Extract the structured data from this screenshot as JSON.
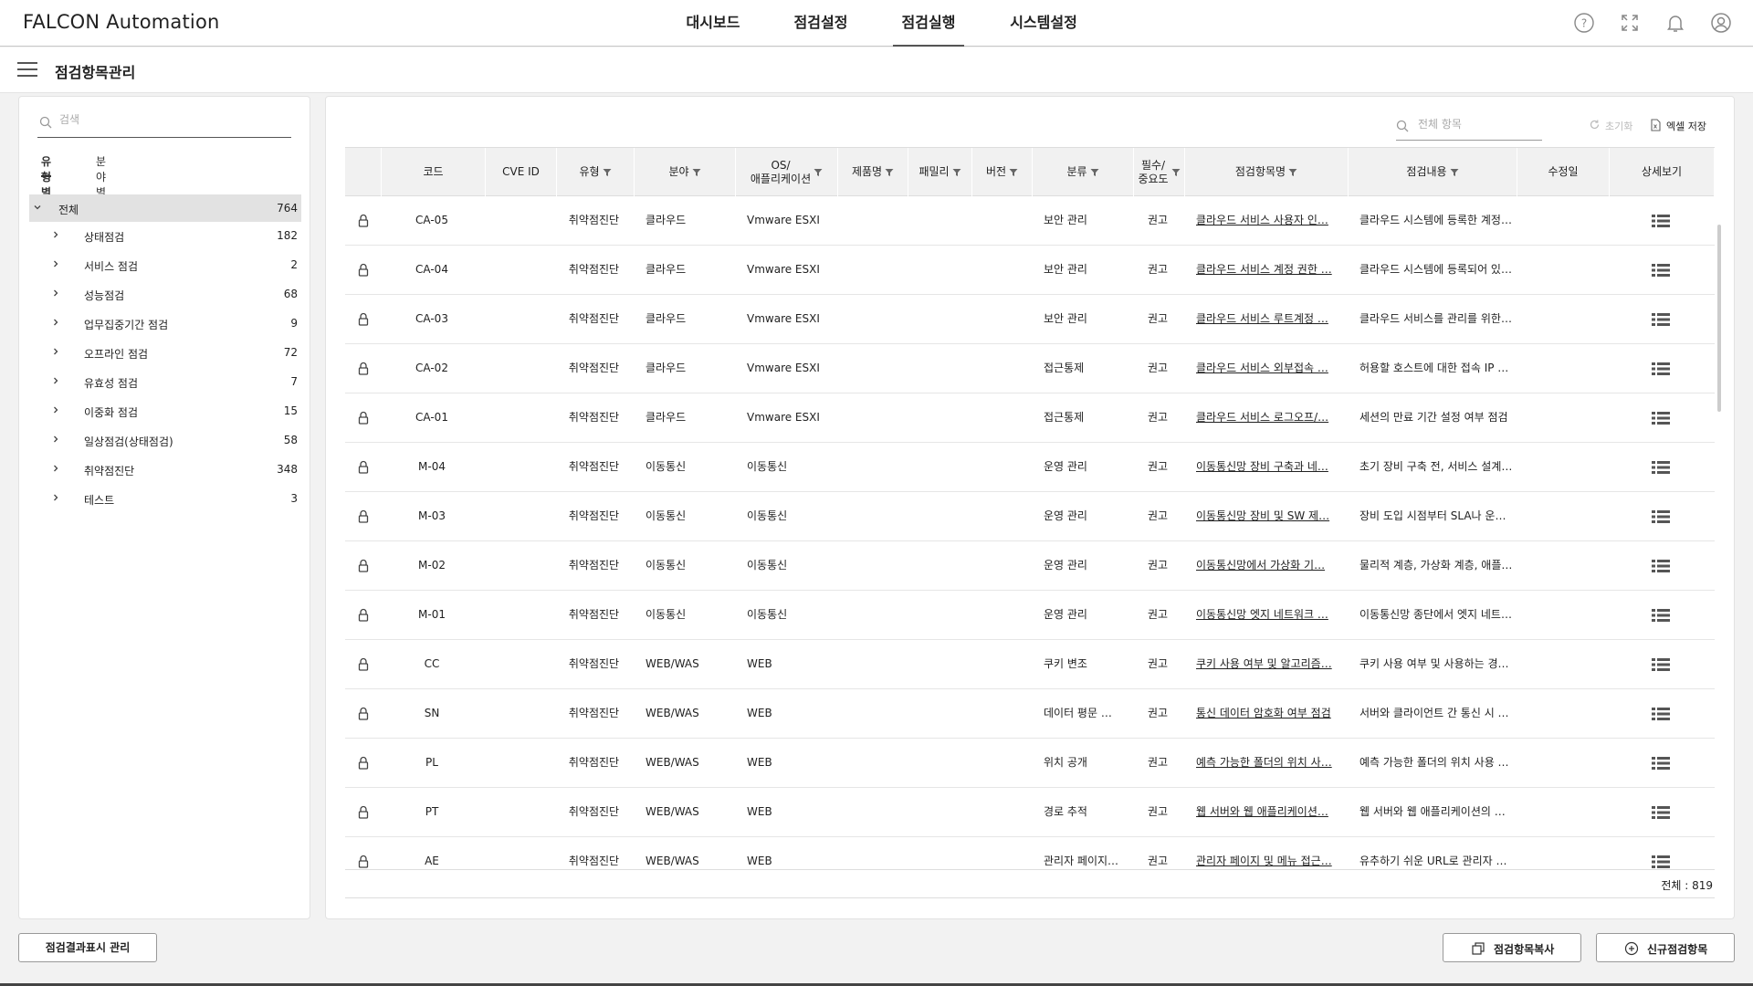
{
  "app": {
    "title": "FALCON Automation"
  },
  "nav": {
    "items": [
      "대시보드",
      "점검설정",
      "점검실행",
      "시스템설정"
    ],
    "active_index": 2
  },
  "header_icons": [
    "help-icon",
    "fullscreen-icon",
    "bell-icon",
    "user-icon"
  ],
  "page": {
    "title": "점검항목관리"
  },
  "left": {
    "search_placeholder": "검색",
    "tabs": [
      "유형별",
      "분야별"
    ],
    "active_tab": 0,
    "tree": {
      "root": {
        "label": "전체",
        "count": "764"
      },
      "items": [
        {
          "label": "상태점검",
          "count": "182"
        },
        {
          "label": "서비스 점검",
          "count": "2"
        },
        {
          "label": "성능점검",
          "count": "68"
        },
        {
          "label": "업무집중기간 점검",
          "count": "9"
        },
        {
          "label": "오프라인 점검",
          "count": "72"
        },
        {
          "label": "유효성 점검",
          "count": "7"
        },
        {
          "label": "이중화 점검",
          "count": "15"
        },
        {
          "label": "일상점검(상태점검)",
          "count": "58"
        },
        {
          "label": "취약점진단",
          "count": "348"
        },
        {
          "label": "테스트",
          "count": "3"
        }
      ]
    },
    "bottom_button": "점검결과표시 관리"
  },
  "right": {
    "search_placeholder": "전체 항목",
    "reset_label": "초기화",
    "excel_label": "엑셀 저장",
    "columns": [
      {
        "label": ""
      },
      {
        "label": "코드"
      },
      {
        "label": "CVE ID"
      },
      {
        "label": "유형",
        "filter": true
      },
      {
        "label": "분야",
        "filter": true
      },
      {
        "label": "OS/\n애플리케이션",
        "filter": true
      },
      {
        "label": "제품명",
        "filter": true
      },
      {
        "label": "패밀리",
        "filter": true
      },
      {
        "label": "버전",
        "filter": true
      },
      {
        "label": "분류",
        "filter": true
      },
      {
        "label": "필수/\n중요도",
        "filter": true
      },
      {
        "label": "점검항목명",
        "filter": true
      },
      {
        "label": "점검내용",
        "filter": true
      },
      {
        "label": "수정일"
      },
      {
        "label": "상세보기"
      }
    ],
    "rows": [
      {
        "code": "CA-05",
        "cve": "",
        "type": "취약점진단",
        "field": "클라우드",
        "os": "Vmware ESXI",
        "product": "",
        "family": "",
        "version": "",
        "category": "보안 관리",
        "required": "권고",
        "name": "클라우드 서비스 사용자 인…",
        "content": "클라우드 시스템에 등록한 계정…",
        "modified": ""
      },
      {
        "code": "CA-04",
        "cve": "",
        "type": "취약점진단",
        "field": "클라우드",
        "os": "Vmware ESXI",
        "product": "",
        "family": "",
        "version": "",
        "category": "보안 관리",
        "required": "권고",
        "name": "클라우드 서비스 계정 권한 …",
        "content": "클라우드 시스템에 등록되어 있…",
        "modified": ""
      },
      {
        "code": "CA-03",
        "cve": "",
        "type": "취약점진단",
        "field": "클라우드",
        "os": "Vmware ESXI",
        "product": "",
        "family": "",
        "version": "",
        "category": "보안 관리",
        "required": "권고",
        "name": "클라우드 서비스 루트계정 …",
        "content": "클라우드 서비스를 관리를 위한 …",
        "modified": ""
      },
      {
        "code": "CA-02",
        "cve": "",
        "type": "취약점진단",
        "field": "클라우드",
        "os": "Vmware ESXI",
        "product": "",
        "family": "",
        "version": "",
        "category": "접근통제",
        "required": "권고",
        "name": "클라우드 서비스 외부접속 …",
        "content": "허용할 호스트에 대한 접속 IP …",
        "modified": ""
      },
      {
        "code": "CA-01",
        "cve": "",
        "type": "취약점진단",
        "field": "클라우드",
        "os": "Vmware ESXI",
        "product": "",
        "family": "",
        "version": "",
        "category": "접근통제",
        "required": "권고",
        "name": "클라우드 서비스 로그오프/…",
        "content": "세션의 만료 기간 설정 여부 점검",
        "modified": ""
      },
      {
        "code": "M-04",
        "cve": "",
        "type": "취약점진단",
        "field": "이동통신",
        "os": "이동통신",
        "product": "",
        "family": "",
        "version": "",
        "category": "운영 관리",
        "required": "권고",
        "name": "이동통신망 장비 구축과 네…",
        "content": "초기 장비 구축 전, 서비스 설계,…",
        "modified": ""
      },
      {
        "code": "M-03",
        "cve": "",
        "type": "취약점진단",
        "field": "이동통신",
        "os": "이동통신",
        "product": "",
        "family": "",
        "version": "",
        "category": "운영 관리",
        "required": "권고",
        "name": "이동통신망 장비 및 SW 제…",
        "content": "장비 도입 시점부터 SLA나 운영…",
        "modified": ""
      },
      {
        "code": "M-02",
        "cve": "",
        "type": "취약점진단",
        "field": "이동통신",
        "os": "이동통신",
        "product": "",
        "family": "",
        "version": "",
        "category": "운영 관리",
        "required": "권고",
        "name": "이동통신망에서 가상화 기…",
        "content": "물리적 계층, 가상화 계층, 애플…",
        "modified": ""
      },
      {
        "code": "M-01",
        "cve": "",
        "type": "취약점진단",
        "field": "이동통신",
        "os": "이동통신",
        "product": "",
        "family": "",
        "version": "",
        "category": "운영 관리",
        "required": "권고",
        "name": "이동통신망 엣지 네트워크 …",
        "content": "이동통신망 종단에서 엣지 네트…",
        "modified": ""
      },
      {
        "code": "CC",
        "cve": "",
        "type": "취약점진단",
        "field": "WEB/WAS",
        "os": "WEB",
        "product": "",
        "family": "",
        "version": "",
        "category": "쿠키 변조",
        "required": "권고",
        "name": "쿠키 사용 여부 및 알고리즘…",
        "content": "쿠키 사용 여부 및 사용하는 경…",
        "modified": ""
      },
      {
        "code": "SN",
        "cve": "",
        "type": "취약점진단",
        "field": "WEB/WAS",
        "os": "WEB",
        "product": "",
        "family": "",
        "version": "",
        "category": "데이터 평문 …",
        "required": "권고",
        "name": "통신 데이터 암호화 여부 점검",
        "content": "서버와 클라이언트 간 통신 시 …",
        "modified": ""
      },
      {
        "code": "PL",
        "cve": "",
        "type": "취약점진단",
        "field": "WEB/WAS",
        "os": "WEB",
        "product": "",
        "family": "",
        "version": "",
        "category": "위치 공개",
        "required": "권고",
        "name": "예측 가능한 폴더의 위치 사…",
        "content": "예측 가능한 폴더의 위치 사용 …",
        "modified": ""
      },
      {
        "code": "PT",
        "cve": "",
        "type": "취약점진단",
        "field": "WEB/WAS",
        "os": "WEB",
        "product": "",
        "family": "",
        "version": "",
        "category": "경로 추적",
        "required": "권고",
        "name": "웹 서버와 웹 애플리케이션…",
        "content": "웹 서버와 웹 애플리케이션의 파…",
        "modified": ""
      },
      {
        "code": "AE",
        "cve": "",
        "type": "취약점진단",
        "field": "WEB/WAS",
        "os": "WEB",
        "product": "",
        "family": "",
        "version": "",
        "category": "관리자 페이지…",
        "required": "권고",
        "name": "관리자 페이지 및 메뉴 접근…",
        "content": "유추하기 쉬운 URL로 관리자 페…",
        "modified": ""
      }
    ],
    "total_label": "전체 : 819",
    "copy_button": "점검항목복사",
    "new_button": "신규점검항목"
  }
}
